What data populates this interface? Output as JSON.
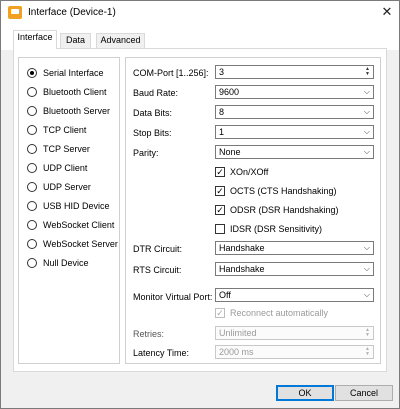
{
  "window": {
    "title": "Interface (Device-1)",
    "close_glyph": "✕"
  },
  "tabs": [
    {
      "label": "Interface",
      "active": true
    },
    {
      "label": "Data",
      "active": false
    },
    {
      "label": "Advanced",
      "active": false
    }
  ],
  "interfaces": [
    {
      "label": "Serial Interface",
      "selected": true
    },
    {
      "label": "Bluetooth Client",
      "selected": false
    },
    {
      "label": "Bluetooth Server",
      "selected": false
    },
    {
      "label": "TCP Client",
      "selected": false
    },
    {
      "label": "TCP Server",
      "selected": false
    },
    {
      "label": "UDP Client",
      "selected": false
    },
    {
      "label": "UDP Server",
      "selected": false
    },
    {
      "label": "USB HID Device",
      "selected": false
    },
    {
      "label": "WebSocket Client",
      "selected": false
    },
    {
      "label": "WebSocket Server",
      "selected": false
    },
    {
      "label": "Null Device",
      "selected": false
    }
  ],
  "settings": {
    "com_port": {
      "label": "COM-Port [1..256]:",
      "value": "3"
    },
    "baud_rate": {
      "label": "Baud Rate:",
      "value": "9600"
    },
    "data_bits": {
      "label": "Data Bits:",
      "value": "8"
    },
    "stop_bits": {
      "label": "Stop Bits:",
      "value": "1"
    },
    "parity": {
      "label": "Parity:",
      "value": "None"
    },
    "xon_xoff": {
      "label": "XOn/XOff",
      "checked": true
    },
    "octs": {
      "label": "OCTS (CTS Handshaking)",
      "checked": true
    },
    "odsr": {
      "label": "ODSR (DSR Handshaking)",
      "checked": true
    },
    "idsr": {
      "label": "IDSR (DSR Sensitivity)",
      "checked": false
    },
    "dtr_circuit": {
      "label": "DTR Circuit:",
      "value": "Handshake"
    },
    "rts_circuit": {
      "label": "RTS Circuit:",
      "value": "Handshake"
    },
    "monitor_virtual_port": {
      "label": "Monitor Virtual Port:",
      "value": "Off"
    },
    "reconnect": {
      "label": "Reconnect automatically",
      "checked": true,
      "enabled": false
    },
    "retries": {
      "label": "Retries:",
      "value": "Unlimited"
    },
    "latency_time": {
      "label": "Latency Time:",
      "value": "2000 ms"
    }
  },
  "buttons": {
    "ok": "OK",
    "cancel": "Cancel"
  },
  "icons": {
    "dropdown": "chevron-down-icon",
    "spin": "spinner-arrows-icon",
    "check": "checkmark-icon"
  },
  "colors": {
    "accent": "#0078d7",
    "app_icon": "#f0a022"
  }
}
